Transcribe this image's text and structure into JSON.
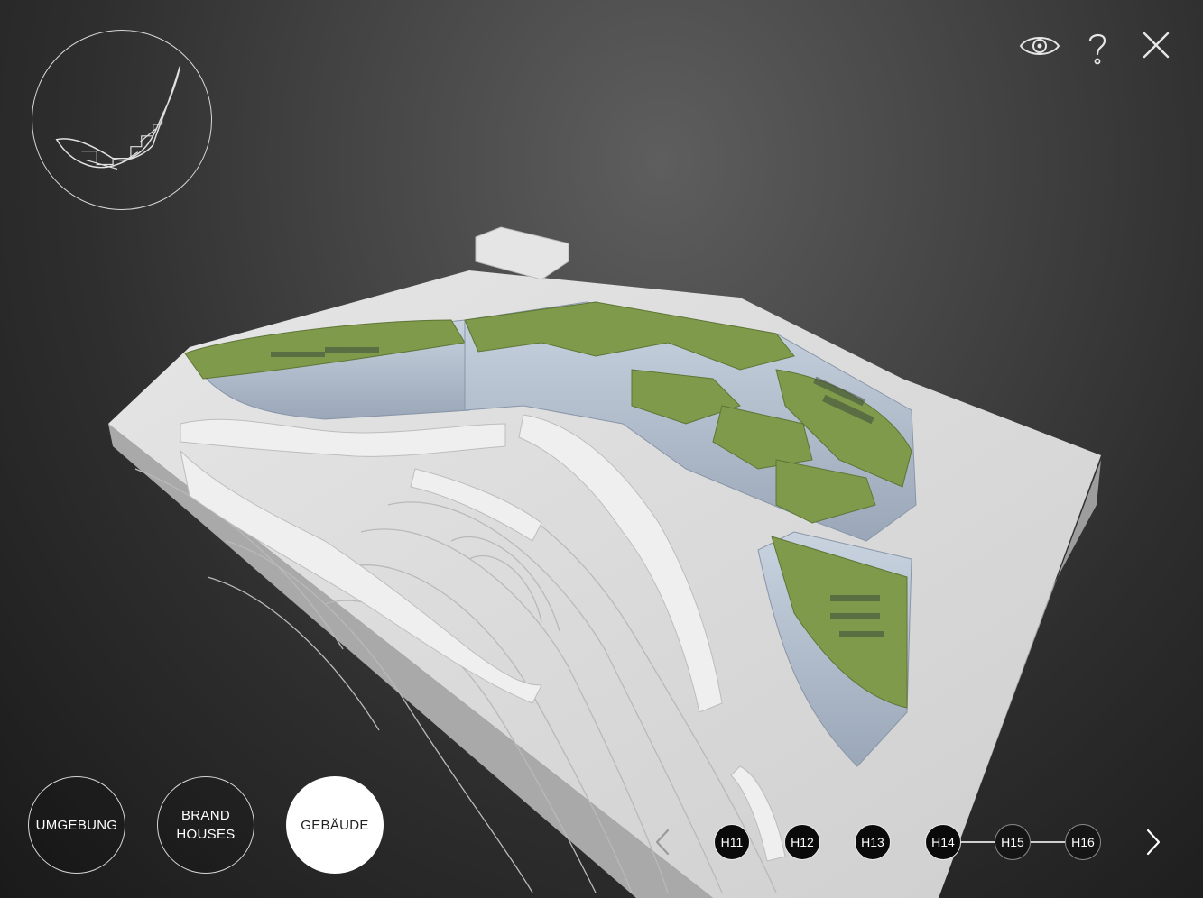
{
  "toolbar": {
    "view_icon": "eye-icon",
    "help_icon": "question-mark-icon",
    "close_icon": "close-icon"
  },
  "minimap": {
    "icon": "site-outline-map"
  },
  "modes": [
    {
      "label": "UMGEBUNG",
      "active": false
    },
    {
      "label": "BRAND\nHOUSES",
      "active": false
    },
    {
      "label": "GEBÄUDE",
      "active": true
    }
  ],
  "buildings": [
    {
      "label": "H11"
    },
    {
      "label": "H12"
    },
    {
      "label": "H13"
    },
    {
      "label": "H14"
    },
    {
      "label": "H15"
    },
    {
      "label": "H16"
    }
  ],
  "nav": {
    "prev_icon": "chevron-left-icon",
    "next_icon": "chevron-right-icon"
  },
  "colors": {
    "background": "#2b2b2b",
    "roof_green": "#7e9a4a",
    "terrain": "#d9d9d9",
    "glass": "#b8c4d4",
    "active_mode": "#ffffff"
  }
}
